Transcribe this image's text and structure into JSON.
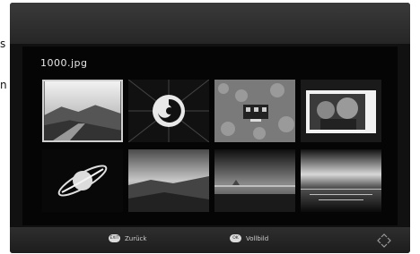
{
  "viewer": {
    "filename": "1000.jpg",
    "thumbnails": [
      {
        "name": "mountain-road",
        "selected": true
      },
      {
        "name": "spiral",
        "selected": false
      },
      {
        "name": "house-field",
        "selected": false
      },
      {
        "name": "two-people",
        "selected": false
      },
      {
        "name": "saturn",
        "selected": false
      },
      {
        "name": "valley-road",
        "selected": false
      },
      {
        "name": "sea-horizon",
        "selected": false
      },
      {
        "name": "sunset-water",
        "selected": false
      }
    ]
  },
  "footer": {
    "back": {
      "key": "EXIT",
      "label": "Zurück"
    },
    "fullscreen": {
      "key": "OK",
      "label": "Vollbild"
    },
    "nav_icon": "dpad-icon"
  },
  "page_edge": {
    "top_char": "s",
    "bottom_char": "n"
  }
}
